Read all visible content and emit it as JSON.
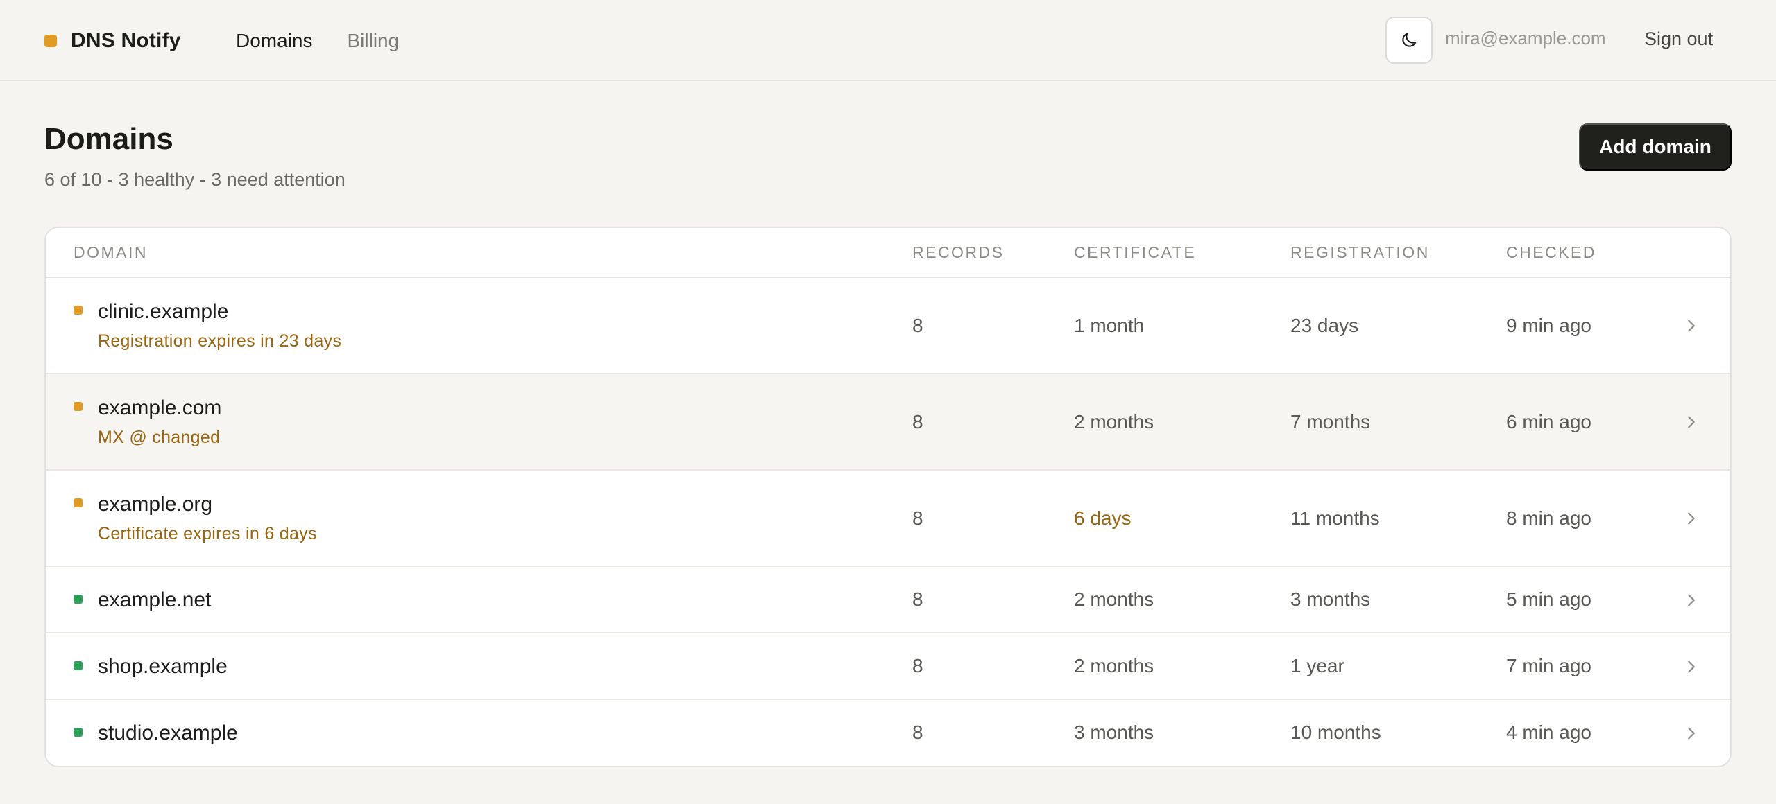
{
  "app": {
    "brand": "DNS Notify",
    "accent_color": "#e19a23",
    "nav": [
      {
        "label": "Domains",
        "active": true
      },
      {
        "label": "Billing",
        "active": false
      }
    ],
    "theme_toggle_icon": "moon-icon",
    "user_email": "mira@example.com",
    "sign_out": "Sign out"
  },
  "page": {
    "title": "Domains",
    "summary": "6 of 10 - 3 healthy - 3 need attention",
    "add_button": "Add domain"
  },
  "table": {
    "columns": [
      "Domain",
      "Records",
      "Certificate",
      "Registration",
      "Checked"
    ],
    "rows": [
      {
        "domain": "clinic.example",
        "status": "warning",
        "note": "Registration expires in 23 days",
        "records": "8",
        "certificate": "1 month",
        "registration": "23 days",
        "checked": "9 min ago"
      },
      {
        "domain": "example.com",
        "status": "warning",
        "note": "MX @ changed",
        "records": "8",
        "certificate": "2 months",
        "registration": "7 months",
        "checked": "6 min ago"
      },
      {
        "domain": "example.org",
        "status": "warning",
        "note": "Certificate expires in 6 days",
        "records": "8",
        "certificate": "6 days",
        "registration": "11 months",
        "checked": "8 min ago"
      },
      {
        "domain": "example.net",
        "status": "healthy",
        "records": "8",
        "certificate": "2 months",
        "registration": "3 months",
        "checked": "5 min ago"
      },
      {
        "domain": "shop.example",
        "status": "healthy",
        "records": "8",
        "certificate": "2 months",
        "registration": "1 year",
        "checked": "7 min ago"
      },
      {
        "domain": "studio.example",
        "status": "healthy",
        "records": "8",
        "certificate": "3 months",
        "registration": "10 months",
        "checked": "4 min ago"
      }
    ],
    "row_icon": "chevron-right-icon"
  },
  "colors": {
    "warning": "#e19a23",
    "warning_text": "#9a6510",
    "healthy": "#2e9e5b"
  }
}
